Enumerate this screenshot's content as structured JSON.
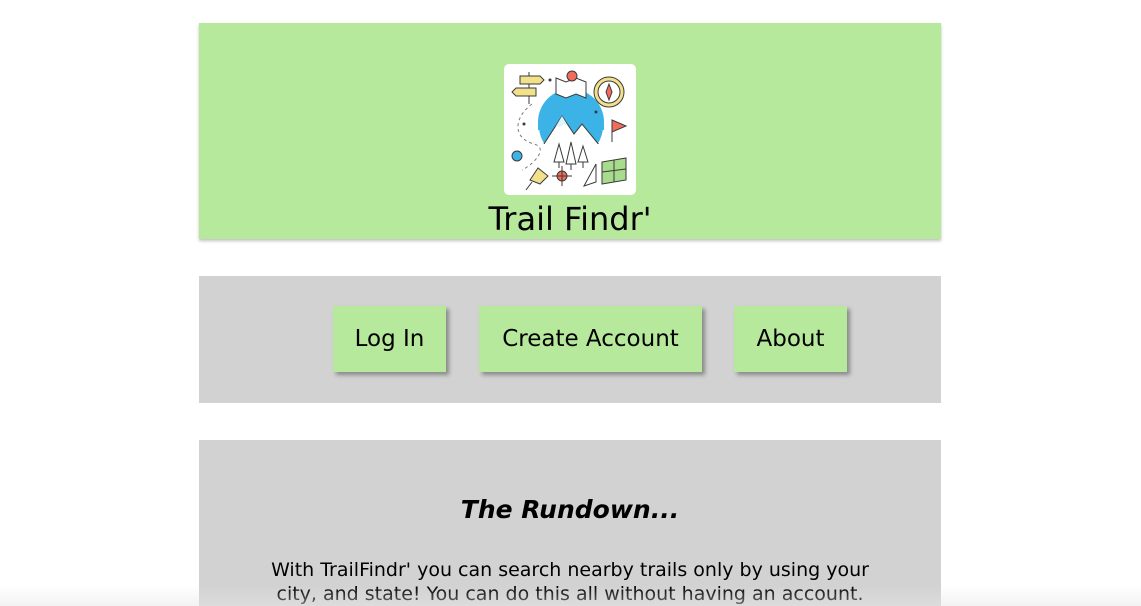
{
  "header": {
    "logo_icon": "trail-map-illustration-icon",
    "title": "Trail Findr'"
  },
  "nav": {
    "login_label": "Log In",
    "create_account_label": "Create Account",
    "about_label": "About"
  },
  "rundown": {
    "title": "The Rundown...",
    "body": "With TrailFindr' you can search nearby trails only by using your city, and state! You can do this all without having an account."
  },
  "colors": {
    "header_bg": "#b7e99d",
    "panel_bg": "#d2d2d2",
    "button_bg": "#b7e99d",
    "logo_circle": "#3bb3e6"
  }
}
